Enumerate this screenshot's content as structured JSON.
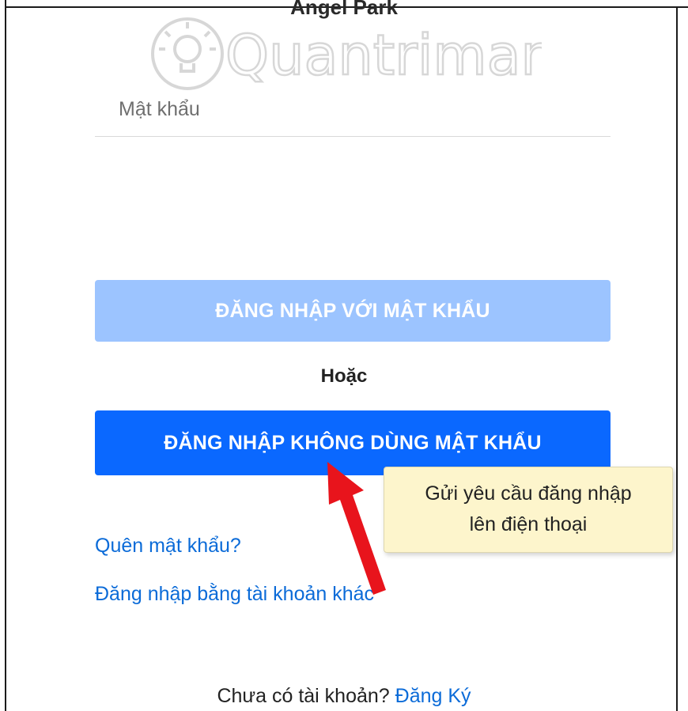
{
  "account": {
    "name": "Angel Park"
  },
  "watermark": {
    "text": "Quantrimang"
  },
  "password_field": {
    "placeholder": "Mật khẩu",
    "value": ""
  },
  "buttons": {
    "login_with_password": "ĐĂNG NHẬP VỚI MẬT KHẨU",
    "login_without_password": "ĐĂNG NHẬP KHÔNG DÙNG MẬT KHẨU"
  },
  "separator": {
    "or": "Hoặc"
  },
  "links": {
    "forgot_password": "Quên mật khẩu?",
    "other_account": "Đăng nhập bằng tài khoản khác"
  },
  "tooltip": {
    "line1": "Gửi yêu cầu đăng nhập",
    "line2": "lên điện thoại"
  },
  "signup": {
    "prompt": "Chưa có tài khoản?",
    "link": "Đăng Ký"
  },
  "colors": {
    "primary_button": "#0a68ff",
    "disabled_button": "#9cc4ff",
    "link": "#0b6bd8",
    "tooltip_bg": "#fdf5cc",
    "arrow": "#e8141c"
  },
  "icons": {
    "annotation": "red-arrow-icon",
    "watermark_logo": "lightbulb-icon"
  }
}
